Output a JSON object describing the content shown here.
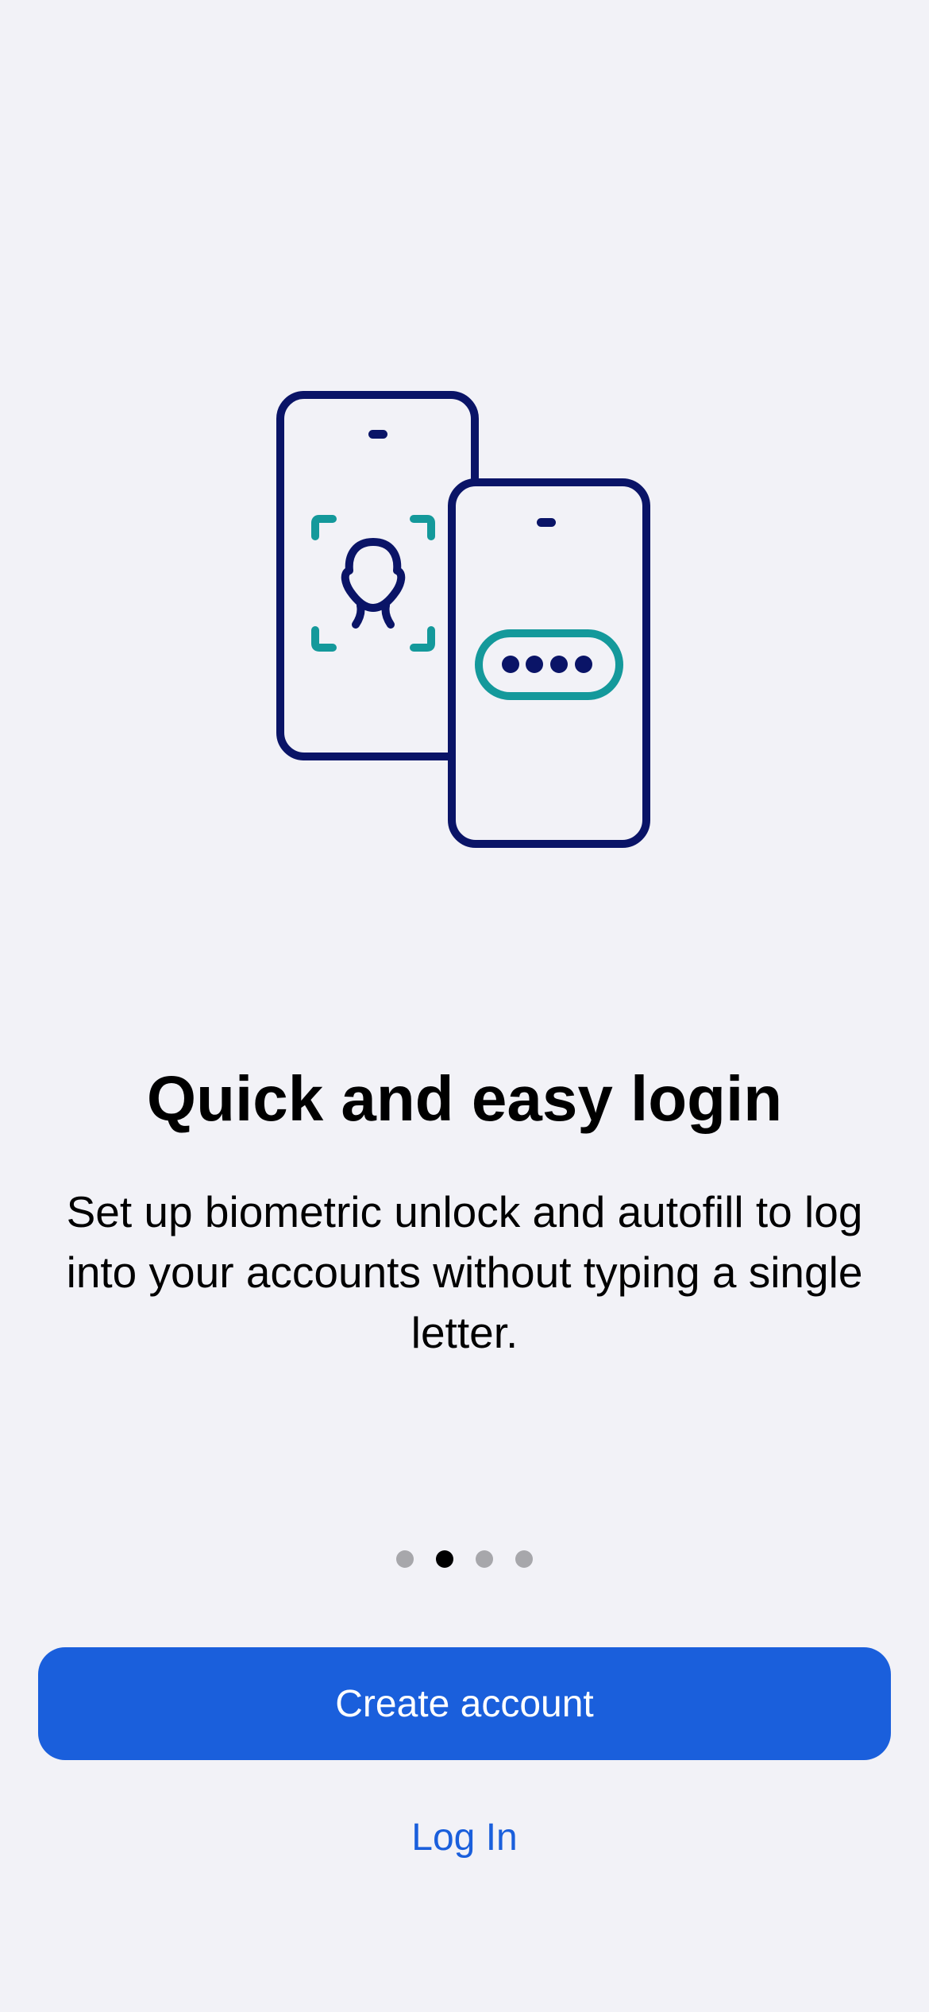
{
  "onboarding": {
    "illustration_icon": "phones-biometric-autofill-illustration",
    "title": "Quick and easy login",
    "subtitle": "Set up biometric unlock and autofill to log into your accounts without typing a single letter.",
    "page_indicator": {
      "total": 4,
      "active_index": 1
    }
  },
  "actions": {
    "create_account_label": "Create account",
    "log_in_label": "Log In"
  },
  "colors": {
    "background": "#f2f2f7",
    "navy": "#0a1467",
    "teal": "#14999b",
    "primary": "#1a5fdc"
  }
}
